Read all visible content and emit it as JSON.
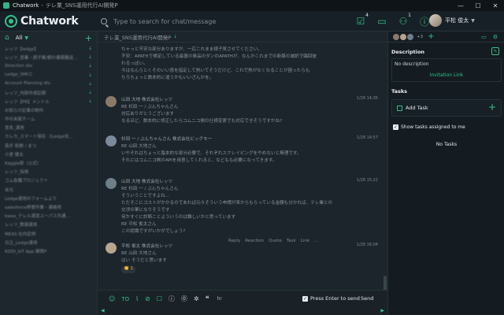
{
  "window": {
    "app_name": "Chatwork",
    "separator": "-",
    "room_title": "テレ業_SNS運用代行AI開発P",
    "controls": [
      "—",
      "☐",
      "✕"
    ]
  },
  "header": {
    "brand": "Chatwork",
    "search_placeholder": "Type to search for chat/message",
    "task_badge": "4",
    "contact_badge": "1",
    "user_name": "平松 俊太"
  },
  "sidebar": {
    "filter_label": "All",
    "rooms": [
      {
        "label": "レッツ【ledge】",
        "pinned": true
      },
      {
        "label": "レッツ_営業・調子案/朝の書類搬送...",
        "pinned": true
      },
      {
        "label": "Direction div.",
        "pinned": true
      },
      {
        "label": "Ledge_SMCC",
        "pinned": true
      },
      {
        "label": "Account Planning div.",
        "pinned": true
      },
      {
        "label": "レッツ_内部作成記録",
        "pinned": true
      },
      {
        "label": "レッツ【PR】メントル",
        "pinned": true
      },
      {
        "label": "お知らせ記事の制作",
        "pinned": false
      },
      {
        "label": "中の末尾チーム",
        "pinned": false
      },
      {
        "label": "宮本_運用",
        "pinned": false
      },
      {
        "label": "カレカ_スマート保存 《Ledge化...",
        "pinned": false
      },
      {
        "label": "長井 和樹 / まつ",
        "pinned": false
      },
      {
        "label": "小室 健太",
        "pinned": false
      },
      {
        "label": "Kaggle部（公式）",
        "pinned": false
      },
      {
        "label": "レッツ_採用",
        "pinned": false
      },
      {
        "label": "コム各種プロジェクト",
        "pinned": false
      },
      {
        "label": "米元",
        "pinned": false
      },
      {
        "label": "Ledge運用のフォームより",
        "pinned": false
      },
      {
        "label": "salesforce移管作業・連絡用",
        "pinned": false
      },
      {
        "label": "kwax_テレル運営ユーパス共通...",
        "pinned": false
      },
      {
        "label": "レッツ_数値運用",
        "pinned": false
      },
      {
        "label": "MEAS 社内定例",
        "pinned": false
      },
      {
        "label": "日立_Ledge運用",
        "pinned": false
      },
      {
        "label": "KDDI_IoT App 開発P",
        "pinned": false
      }
    ]
  },
  "chat": {
    "room_title": "テレ業_SNS運用代行AI開発P",
    "messages": [
      {
        "lines": [
          "ちゃっと不安な部分ありますが、一応これまま様子見させてください。",
          "不安：APATHで検定している最善の単品のダンのAPATHが、なんかこれまでの新築の減訳で臨回彼",
          "わるっぽい。",
          "今はなんらとくそのいい感を指定して熱いてそうだけど、これで熱がなくなることが困ったらも",
          "ちろちょっと数本的に違うかもいいざんかを。"
        ]
      },
      {
        "name": "山田 大地 株式会社レッツ",
        "time": "1/28 14:35",
        "lines": [
          "RE 杉田 一 / ぶんちゃんさん",
          "対応ありがとうございます",
          "なるほど、数本的に修正したらコムニコ側の仕様変更でも対応できそうですかね?"
        ]
      },
      {
        "name": "杉田 一 / ぶんちゃんさん 株式会社ビッグモー",
        "time": "1/28 14:57",
        "lines": [
          "RE 山田 大地さん",
          "いやそれはちょっと脂本的な部分必要で、それぞれスクレイピングをやめないと無理です。",
          "それにはコムニコ側のAPIを用意してくれると、などもも必要になってきます。"
        ]
      },
      {
        "name": "山田 大地 株式会社レッツ",
        "time": "1/28 15:22",
        "lines": [
          "RE 杉田 一 / ぶんちゃんさん",
          "そういうことですよね...",
          "ただそこにコストがかかるのであれば元々そういう申請が来からもらっている金額も分かれば、テレ業との",
          "交渉の軍になりそうです",
          "何かすぐに診断ことよういうのは難しいかと思っています",
          "RE 平松 俊太さん",
          "この認識ですがいかがでしょう?"
        ]
      },
      {
        "name": "平松 俊太 株式会社レッツ",
        "time": "1/28 16:04",
        "lines": [
          "RE 山田 大地さん",
          "はい そうだと思います"
        ]
      }
    ],
    "hover_actions": [
      "Reply",
      "Reaction",
      "Quote",
      "Task",
      "Link",
      "..."
    ],
    "reaction": "👏 1",
    "composer": {
      "to_label": "TO",
      "hr_label": "hr",
      "enter_label": "Press Enter to send",
      "send_label": "Send"
    }
  },
  "right_panel": {
    "member_count": "+3",
    "description_label": "Description",
    "description_text": "No description",
    "invite_label": "Invitation Link",
    "tasks_label": "Tasks",
    "add_task_label": "Add Task",
    "show_assigned_label": "Show tasks assigned to me",
    "no_tasks_label": "No Tasks"
  },
  "colors": {
    "accent": "#31c28c",
    "background": "#1b2328"
  }
}
